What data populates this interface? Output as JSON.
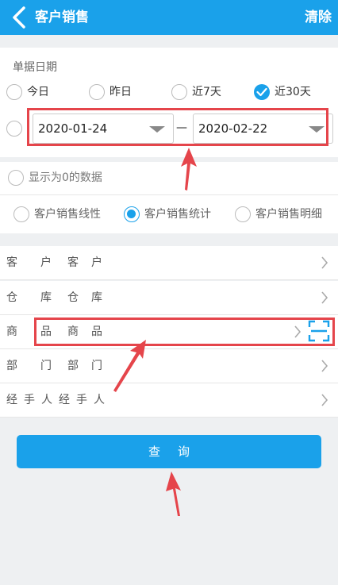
{
  "header": {
    "title": "客户销售",
    "clear_label": "清除"
  },
  "date_section": {
    "label": "单据日期",
    "options": [
      "今日",
      "昨日",
      "近7天",
      "近30天"
    ],
    "selected": "近30天",
    "start_date": "2020-01-24",
    "separator": "—",
    "end_date": "2020-02-22"
  },
  "show_zero_label": "显示为0的数据",
  "report_types": {
    "options": [
      "客户销售线性",
      "客户销售统计",
      "客户销售明细"
    ],
    "selected": "客户销售统计"
  },
  "filters": [
    {
      "a": "客",
      "b": "户客",
      "c": "户"
    },
    {
      "a": "仓",
      "b": "库仓",
      "c": "库"
    },
    {
      "a": "商",
      "b": "品商",
      "c": "品"
    },
    {
      "a": "部",
      "b": "门部",
      "c": "门"
    },
    {
      "a": "经",
      "b": "手人经手人",
      "c": ""
    }
  ],
  "query_label": "查询",
  "colors": {
    "brand": "#1aa1ea",
    "annotation": "#e5454b"
  }
}
